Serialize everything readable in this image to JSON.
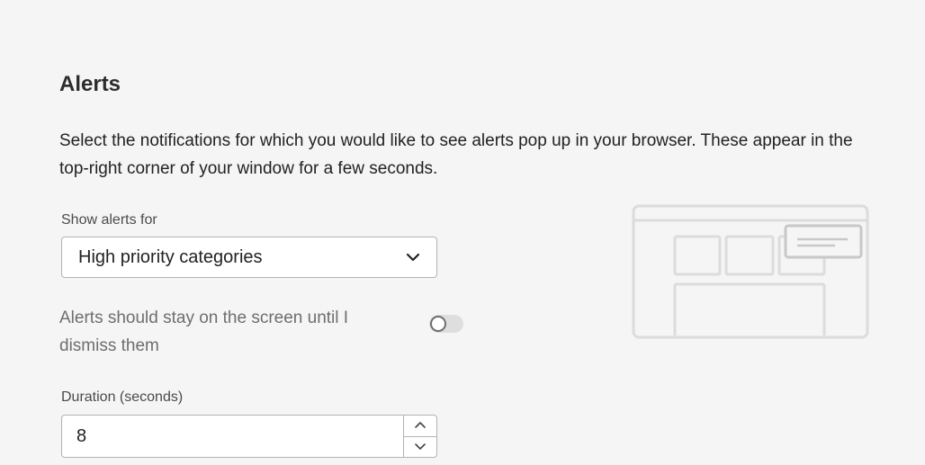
{
  "alerts": {
    "title": "Alerts",
    "description": "Select the notifications for which you would like to see alerts pop up in your browser. These appear in the top-right corner of your window for a few seconds.",
    "show_alerts_label": "Show alerts for",
    "show_alerts_value": "High priority categories",
    "stay_on_screen_label": "Alerts should stay on the screen until I dismiss them",
    "stay_on_screen_enabled": false,
    "duration_label": "Duration (seconds)",
    "duration_value": "8"
  },
  "colors": {
    "background": "#f5f5f5",
    "border": "#b3b3b3",
    "muted_text": "#6e6e6e",
    "illustration_stroke": "#dcdcdc"
  },
  "icons": {
    "select_chevron": "chevron-down-icon",
    "stepper_up": "chevron-up-icon",
    "stepper_down": "chevron-down-icon"
  }
}
